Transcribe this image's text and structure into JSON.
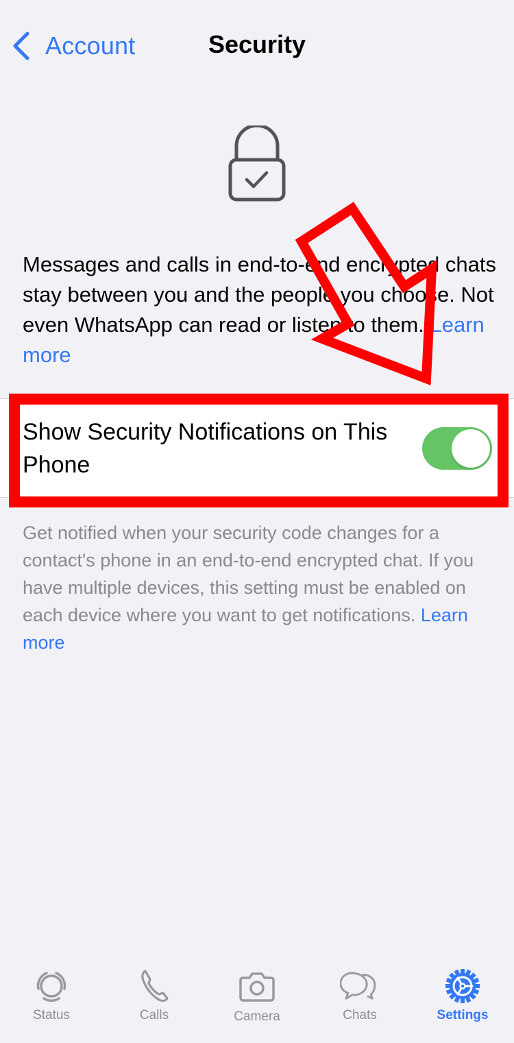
{
  "nav": {
    "back_label": "Account",
    "title": "Security"
  },
  "intro": {
    "text": "Messages and calls in end-to-end encrypted chats stay between you and the people you choose. Not even WhatsApp can read or listen to them. ",
    "link": "Learn more"
  },
  "setting": {
    "label": "Show Security Notifications on This Phone",
    "enabled": true,
    "description": "Get notified when your security code changes for a contact's phone in an end-to-end encrypted chat. If you have multiple devices, this setting must be enabled on each device where you want to get notifications. ",
    "link": "Learn more"
  },
  "tabs": [
    {
      "label": "Status",
      "icon": "status-icon"
    },
    {
      "label": "Calls",
      "icon": "phone-icon"
    },
    {
      "label": "Camera",
      "icon": "camera-icon"
    },
    {
      "label": "Chats",
      "icon": "chats-icon"
    },
    {
      "label": "Settings",
      "icon": "gear-icon",
      "active": true
    }
  ],
  "colors": {
    "accent": "#3478f6",
    "toggle_on": "#65c466",
    "annotation": "#ff0000",
    "background": "#f2f1f6"
  }
}
